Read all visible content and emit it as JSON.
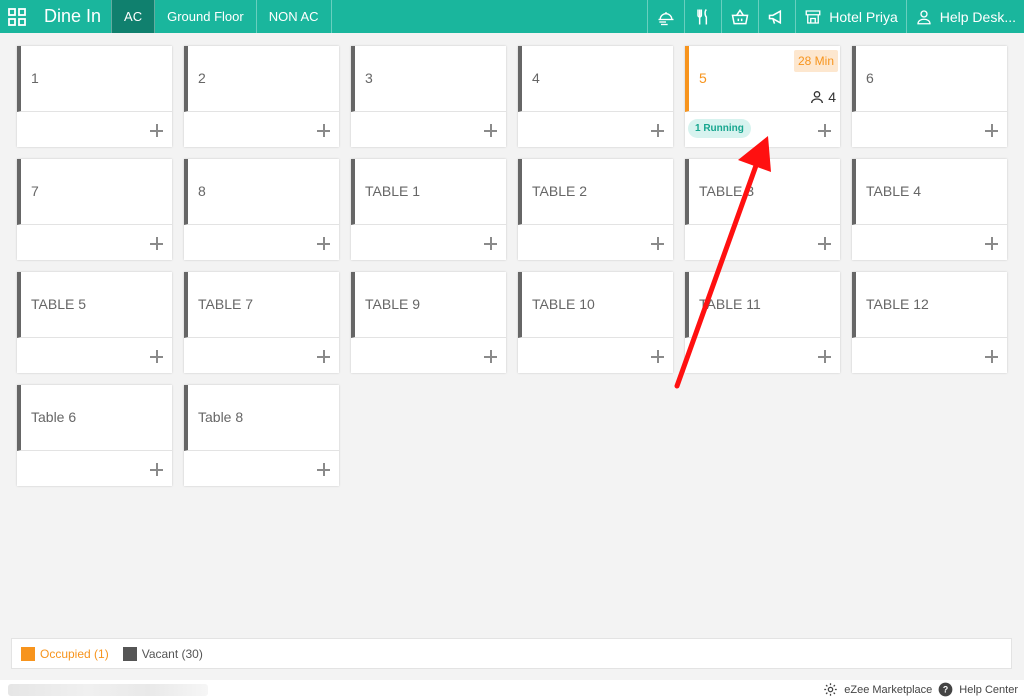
{
  "header": {
    "app_title": "Dine In",
    "tabs": [
      {
        "label": "AC",
        "active": true
      },
      {
        "label": "Ground Floor",
        "active": false
      },
      {
        "label": "NON AC",
        "active": false
      }
    ],
    "icons": [
      "grid-icon",
      "delivery-icon",
      "dine-icon",
      "basket-icon",
      "megaphone-icon",
      "store-icon",
      "user-icon"
    ],
    "hotel_label": "Hotel Priya",
    "help_label": "Help Desk..."
  },
  "tables": [
    {
      "name": "1",
      "status": "vacant"
    },
    {
      "name": "2",
      "status": "vacant"
    },
    {
      "name": "3",
      "status": "vacant"
    },
    {
      "name": "4",
      "status": "vacant"
    },
    {
      "name": "5",
      "status": "occupied",
      "timer": "28 Min",
      "guests": "4",
      "running": "1 Running"
    },
    {
      "name": "6",
      "status": "vacant"
    },
    {
      "name": "7",
      "status": "vacant"
    },
    {
      "name": "8",
      "status": "vacant"
    },
    {
      "name": "TABLE 1",
      "status": "vacant"
    },
    {
      "name": "TABLE 2",
      "status": "vacant"
    },
    {
      "name": "TABLE 3",
      "status": "vacant"
    },
    {
      "name": "TABLE 4",
      "status": "vacant"
    },
    {
      "name": "TABLE 5",
      "status": "vacant"
    },
    {
      "name": "TABLE 7",
      "status": "vacant"
    },
    {
      "name": "TABLE 9",
      "status": "vacant"
    },
    {
      "name": "TABLE 10",
      "status": "vacant"
    },
    {
      "name": "TABLE 11",
      "status": "vacant"
    },
    {
      "name": "TABLE 12",
      "status": "vacant"
    },
    {
      "name": "Table 6",
      "status": "vacant"
    },
    {
      "name": "Table 8",
      "status": "vacant"
    }
  ],
  "legend": {
    "occupied_label": "Occupied (1)",
    "vacant_label": "Vacant (30)",
    "occupied_color": "#f7941d",
    "vacant_color": "#555555"
  },
  "footer": {
    "marketplace_label": "eZee Marketplace",
    "help_center_label": "Help Center"
  },
  "colors": {
    "brand": "#1ab69d",
    "active_tab": "#10806e",
    "annotation_arrow": "#ff0000"
  }
}
